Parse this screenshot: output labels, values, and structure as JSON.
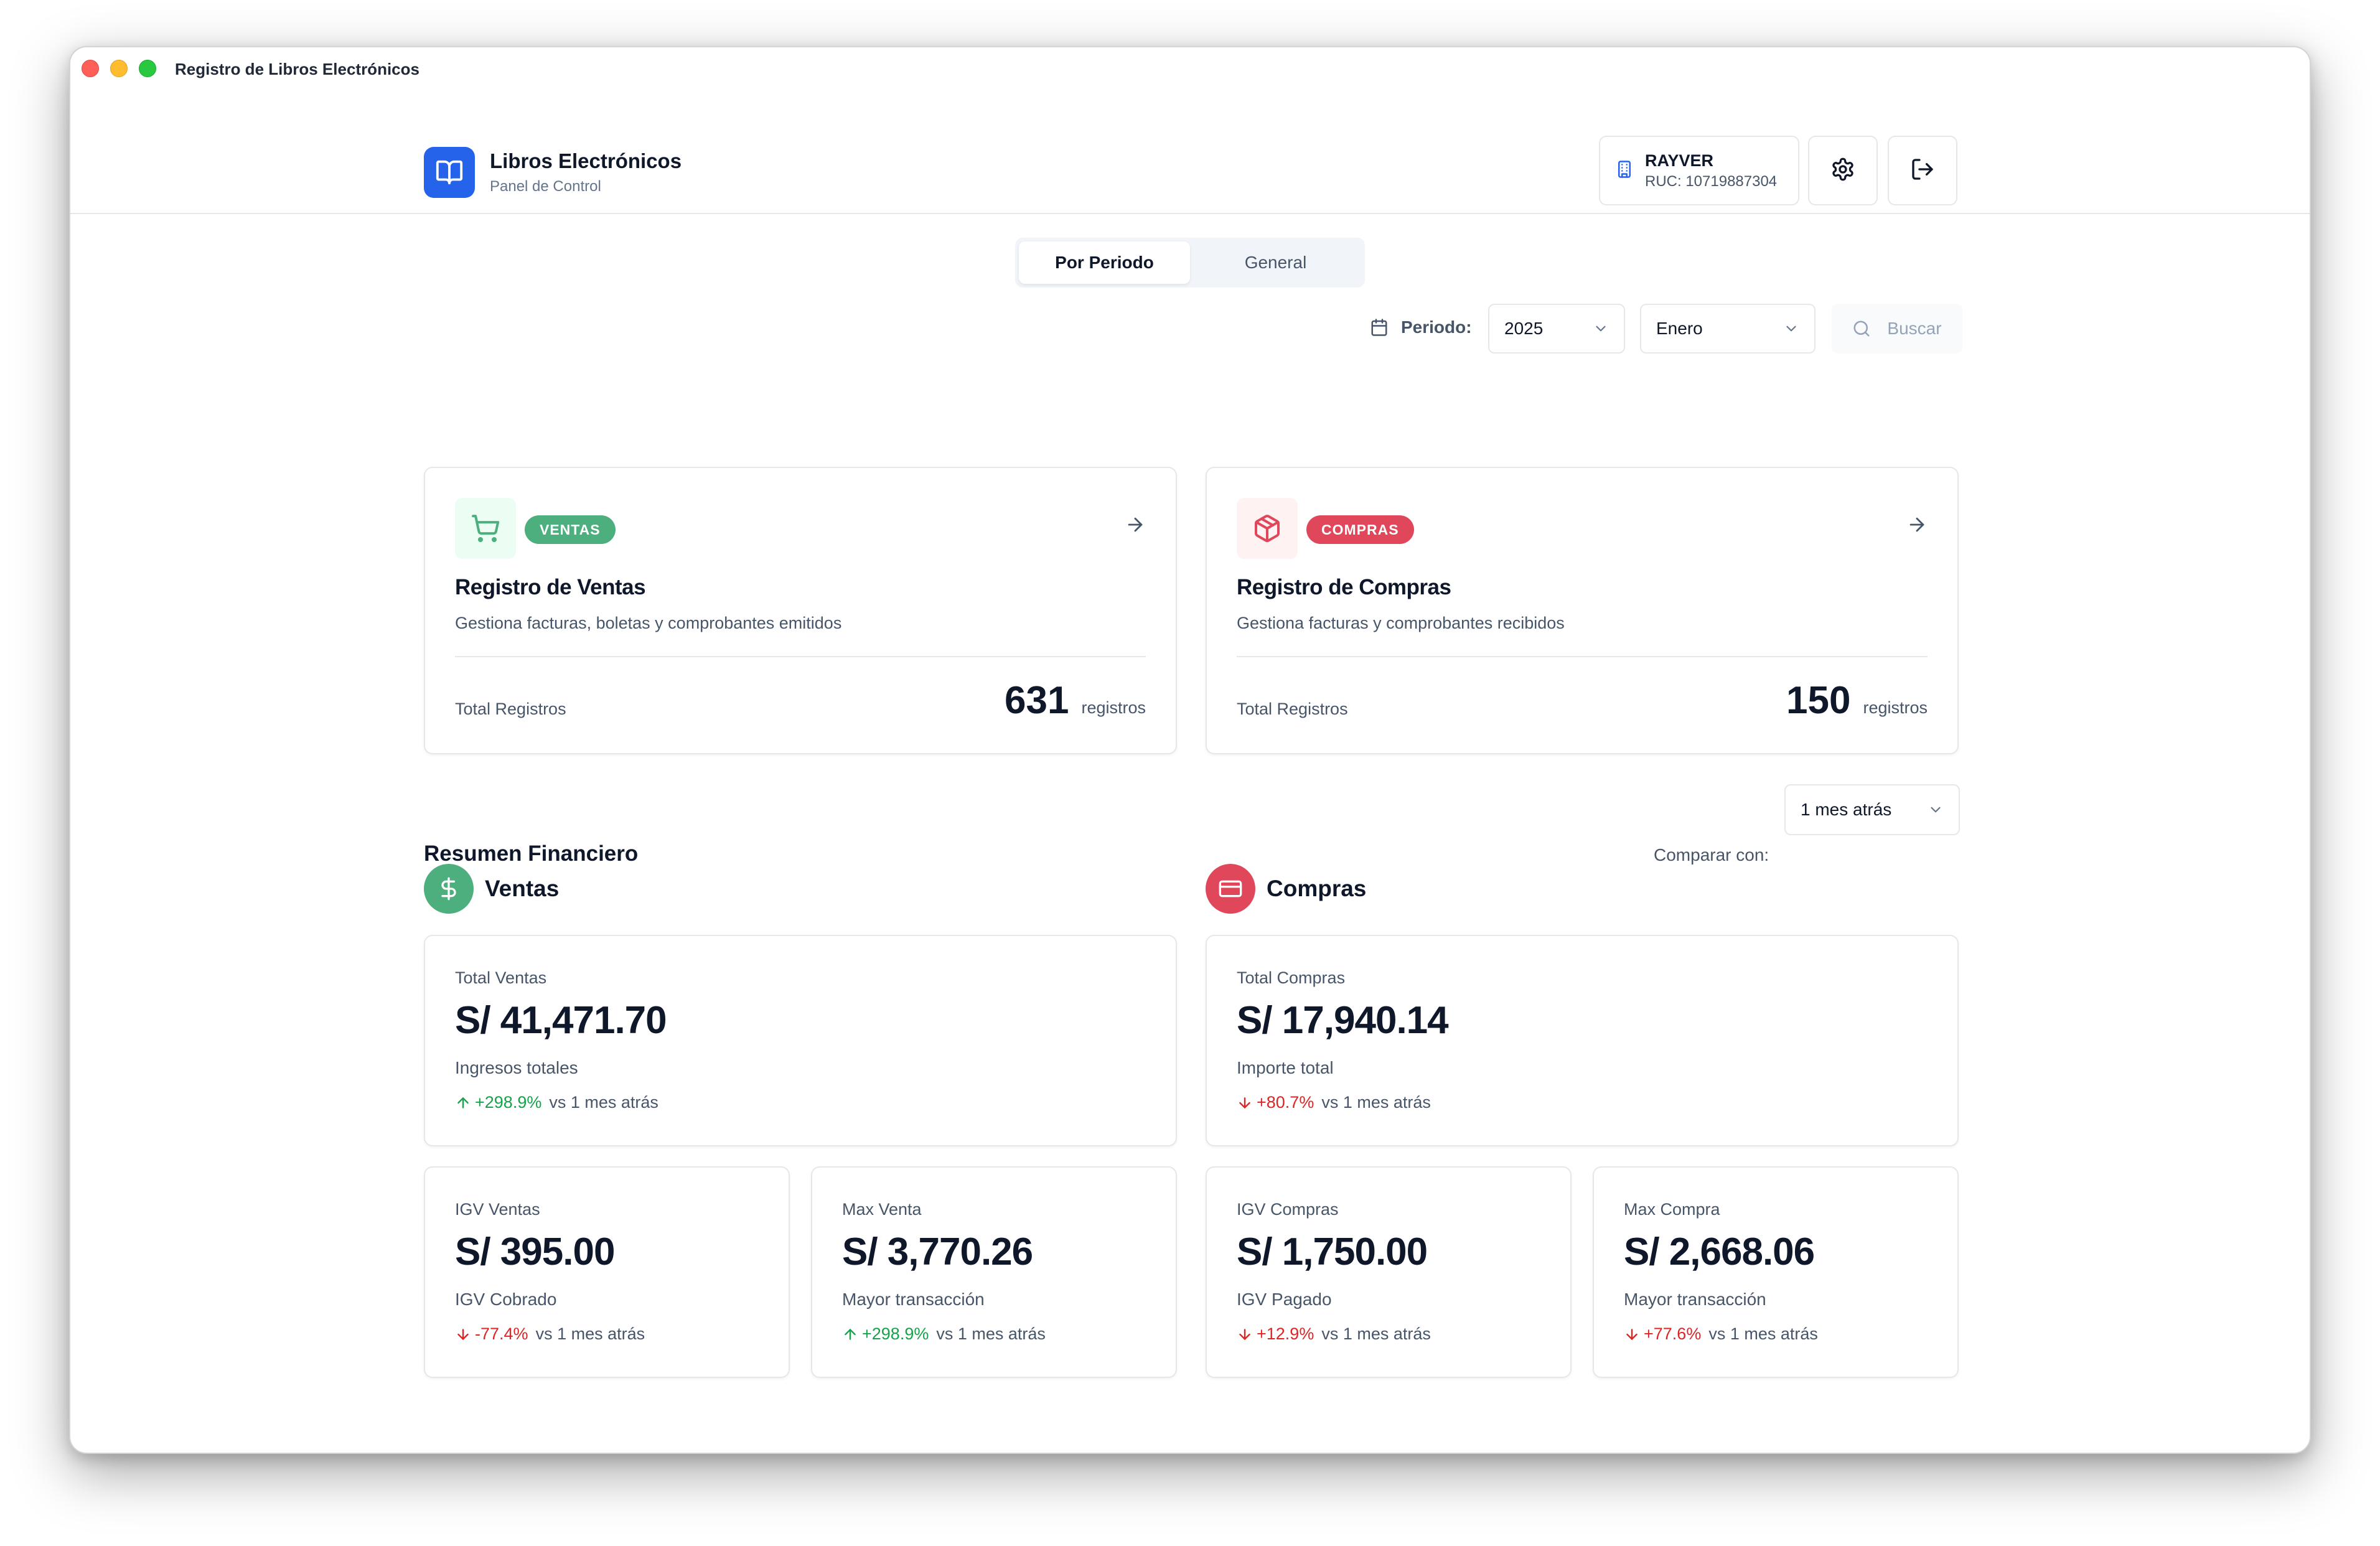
{
  "window": {
    "title": "Registro de Libros Electrónicos"
  },
  "brand": {
    "title": "Libros Electrónicos",
    "subtitle": "Panel de Control"
  },
  "company": {
    "name": "RAYVER",
    "ruc": "RUC: 10719887304"
  },
  "tabs": [
    {
      "label": "Por Periodo",
      "active": true
    },
    {
      "label": "General",
      "active": false
    }
  ],
  "filters": {
    "period_label": "Periodo:",
    "year": "2025",
    "month": "Enero",
    "search_label": "Buscar"
  },
  "registers": {
    "ventas": {
      "badge": "VENTAS",
      "title": "Registro de Ventas",
      "description": "Gestiona facturas, boletas y comprobantes emitidos",
      "total_label": "Total Registros",
      "total": "631",
      "unit": "registros"
    },
    "compras": {
      "badge": "COMPRAS",
      "title": "Registro de Compras",
      "description": "Gestiona facturas y comprobantes recibidos",
      "total_label": "Total Registros",
      "total": "150",
      "unit": "registros"
    }
  },
  "summary": {
    "title": "Resumen Financiero",
    "compare_label": "Comparar con:",
    "compare_value": "1 mes atrás"
  },
  "ventas": {
    "title": "Ventas",
    "total": {
      "label": "Total Ventas",
      "value": "S/ 41,471.70",
      "desc": "Ingresos totales",
      "change": "+298.9%",
      "vs": "vs 1 mes atrás"
    },
    "igv": {
      "label": "IGV Ventas",
      "value": "S/ 395.00",
      "desc": "IGV Cobrado",
      "change": "-77.4%",
      "vs": "vs 1 mes atrás"
    },
    "max": {
      "label": "Max Venta",
      "value": "S/ 3,770.26",
      "desc": "Mayor transacción",
      "change": "+298.9%",
      "vs": "vs 1 mes atrás"
    }
  },
  "compras": {
    "title": "Compras",
    "total": {
      "label": "Total Compras",
      "value": "S/ 17,940.14",
      "desc": "Importe total",
      "change": "+80.7%",
      "vs": "vs 1 mes atrás"
    },
    "igv": {
      "label": "IGV Compras",
      "value": "S/ 1,750.00",
      "desc": "IGV Pagado",
      "change": "+12.9%",
      "vs": "vs 1 mes atrás"
    },
    "max": {
      "label": "Max Compra",
      "value": "S/ 2,668.06",
      "desc": "Mayor transacción",
      "change": "+77.6%",
      "vs": "vs 1 mes atrás"
    }
  },
  "colors": {
    "brand": "#2563eb",
    "ventas": "#4caf7d",
    "compras": "#e0475a",
    "positive": "#16a34a",
    "negative": "#dc2626"
  }
}
